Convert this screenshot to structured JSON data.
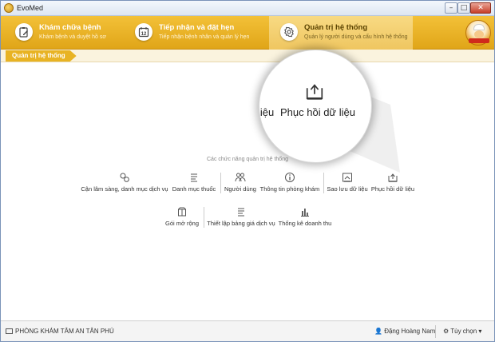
{
  "window": {
    "title": "EvoMed",
    "controls": {
      "minimize": "–",
      "maximize": "□",
      "close": "✕"
    }
  },
  "ribbon": {
    "tabs": [
      {
        "title": "Khám chữa bệnh",
        "subtitle": "Khám bệnh và duyệt hồ sơ",
        "icon": "clipboard-edit-icon",
        "active": false
      },
      {
        "title": "Tiếp nhận và đặt hẹn",
        "subtitle": "Tiếp nhận bệnh nhân và quản lý hẹn",
        "icon": "calendar-icon",
        "calendar_day": "12",
        "active": false
      },
      {
        "title": "Quản trị hệ thống",
        "subtitle": "Quản lý người dùng và cấu hình hệ thống",
        "icon": "gear-icon",
        "active": true
      }
    ]
  },
  "breadcrumb": "Quản trị hệ thống",
  "content": {
    "section_label": "Các chức năng quản trị hệ thống",
    "row1": [
      {
        "label": "Cận lâm sàng, danh mục dịch vụ",
        "icon": "flask-circles-icon"
      },
      {
        "label": "Danh mục thuốc",
        "icon": "list-icon"
      },
      {
        "label": "Người dùng",
        "icon": "users-icon"
      },
      {
        "label": "Thông tin phòng khám",
        "icon": "info-icon"
      },
      {
        "label": "Sao lưu dữ liệu",
        "icon": "backup-icon"
      },
      {
        "label": "Phục hồi dữ liệu",
        "icon": "restore-icon"
      }
    ],
    "row2": [
      {
        "label": "Gói mở rộng",
        "icon": "package-icon"
      },
      {
        "label": "Thiết lập bảng giá dịch vụ",
        "icon": "list-icon"
      },
      {
        "label": "Thống kê doanh thu",
        "icon": "bar-chart-icon"
      }
    ]
  },
  "magnifier": {
    "label": "Phục hồi dữ liệu",
    "partial_label": "liệu",
    "icon": "restore-icon"
  },
  "status": {
    "clinic": "PHÒNG KHÁM TÂM AN TÂN PHÚ",
    "user": "Đặng Hoàng Nam",
    "options": "Tùy chọn"
  },
  "colors": {
    "ribbon": "#e8b323",
    "ribbon_active": "#f3d27a",
    "accent_text": "#5a4200"
  }
}
